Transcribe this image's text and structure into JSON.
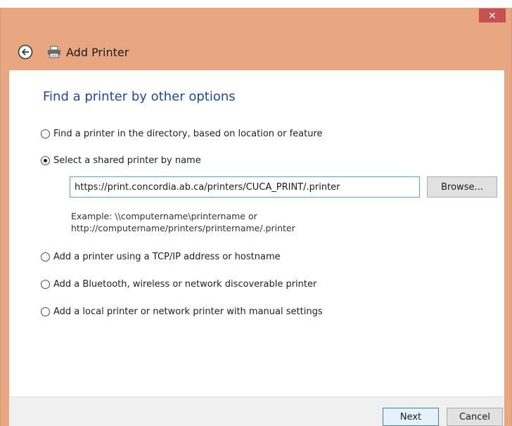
{
  "window": {
    "title": "Add Printer",
    "close_glyph": "✕",
    "accent_color": "#e8a781"
  },
  "main": {
    "heading": "Find a printer by other options",
    "options": [
      {
        "label": "Find a printer in the directory, based on location or feature",
        "checked": false
      },
      {
        "label": "Select a shared printer by name",
        "checked": true
      },
      {
        "label": "Add a printer using a TCP/IP address or hostname",
        "checked": false
      },
      {
        "label": "Add a Bluetooth, wireless or network discoverable printer",
        "checked": false
      },
      {
        "label": "Add a local printer or network printer with manual settings",
        "checked": false
      }
    ],
    "url_value": "https://print.concordia.ab.ca/printers/CUCA_PRINT/.printer",
    "browse_label": "Browse...",
    "example_line1": "Example: \\\\computername\\printername or",
    "example_line2": "http://computername/printers/printername/.printer"
  },
  "footer": {
    "next_label": "Next",
    "cancel_label": "Cancel"
  },
  "icons": {
    "back": "back-arrow-icon",
    "printer": "printer-icon",
    "close": "close-icon"
  }
}
